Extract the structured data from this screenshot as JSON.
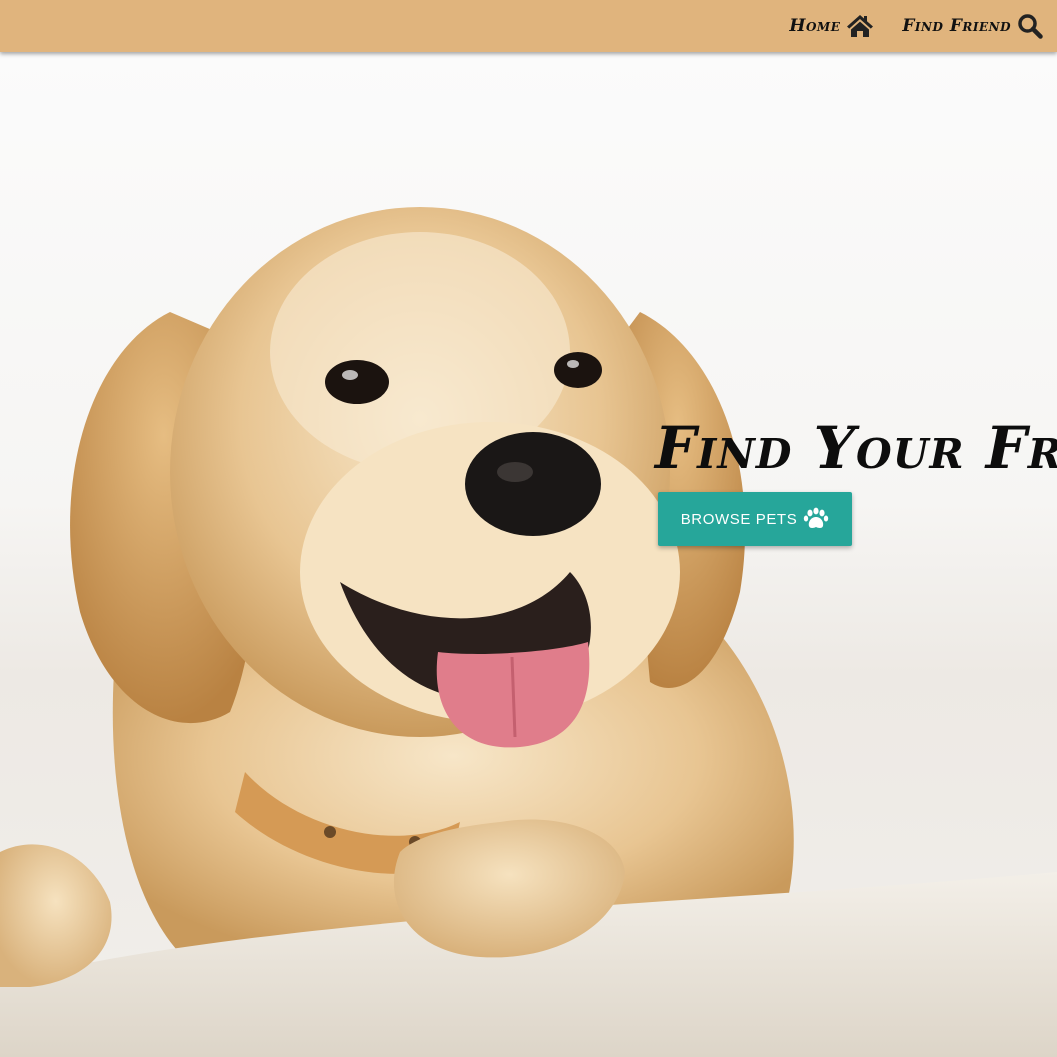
{
  "nav": {
    "home_label": "Home",
    "home_icon": "home-icon",
    "find_label": "Find Friend",
    "find_icon": "search-icon"
  },
  "hero": {
    "title": "Find Your Friend",
    "button_label": "BROWSE PETS",
    "button_icon": "paw-icon",
    "image": "golden-retriever-puppy-photo"
  },
  "colors": {
    "navbar": "#e0b47d",
    "button": "#26a69a",
    "text": "#111111"
  }
}
